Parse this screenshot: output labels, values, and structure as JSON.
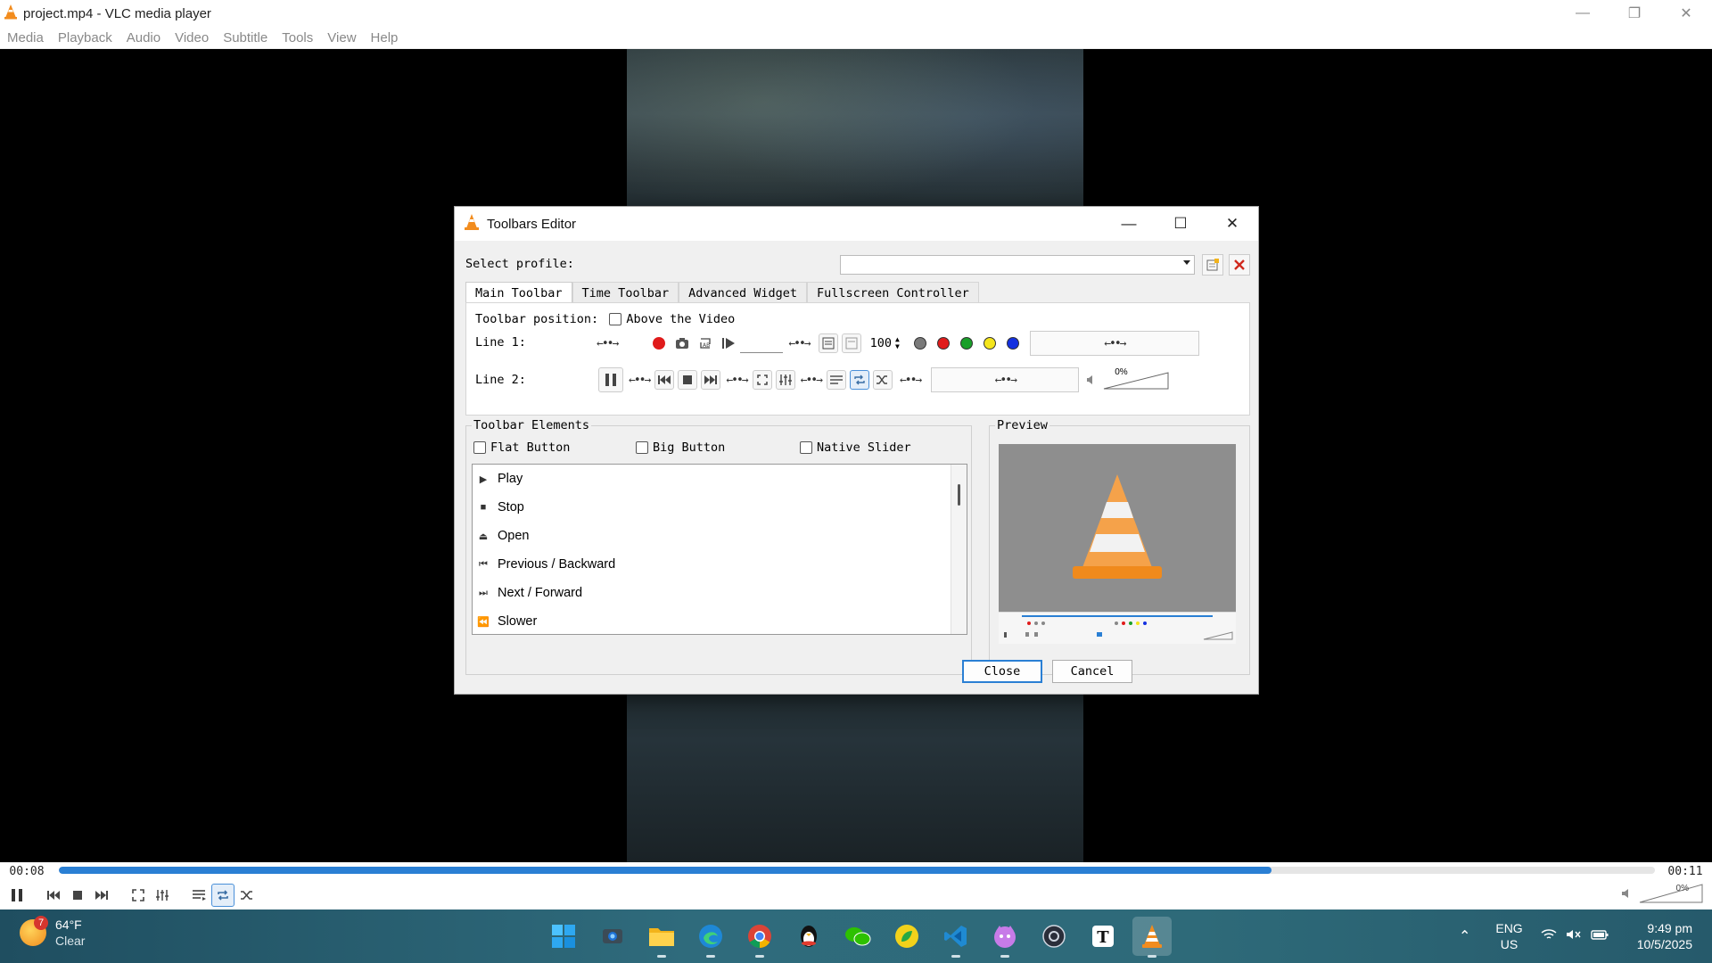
{
  "window": {
    "title": "project.mp4 - VLC media player"
  },
  "menu": [
    "Media",
    "Playback",
    "Audio",
    "Video",
    "Subtitle",
    "Tools",
    "View",
    "Help"
  ],
  "player": {
    "elapsed": "00:08",
    "total": "00:11",
    "progress_fraction": 0.76,
    "volume_label": "0%",
    "volume_fraction": 0.0
  },
  "dialog": {
    "title": "Toolbars Editor",
    "select_profile_label": "Select profile:",
    "profile_value": "",
    "tabs": [
      "Main Toolbar",
      "Time Toolbar",
      "Advanced Widget",
      "Fullscreen Controller"
    ],
    "toolbar_position_label": "Toolbar position:",
    "above_video_label": "Above the Video",
    "above_video_checked": false,
    "line1_label": "Line 1:",
    "line2_label": "Line 2:",
    "line1_speed_value": "100",
    "line2_volume_label": "0%",
    "elements_title": "Toolbar Elements",
    "options": [
      {
        "label": "Flat Button",
        "checked": false
      },
      {
        "label": "Big Button",
        "checked": false
      },
      {
        "label": "Native Slider",
        "checked": false
      }
    ],
    "elements": [
      {
        "label": "Play",
        "icon": "play-icon"
      },
      {
        "label": "Stop",
        "icon": "stop-icon"
      },
      {
        "label": "Open",
        "icon": "eject-icon"
      },
      {
        "label": "Previous / Backward",
        "icon": "previous-icon"
      },
      {
        "label": "Next / Forward",
        "icon": "next-icon"
      },
      {
        "label": "Slower",
        "icon": "slower-icon"
      }
    ],
    "preview_title": "Preview",
    "close_label": "Close",
    "cancel_label": "Cancel"
  },
  "taskbar": {
    "weather_temp": "64°F",
    "weather_cond": "Clear",
    "weather_badge": "7",
    "lang_top": "ENG",
    "lang_bottom": "US",
    "time": "9:49 pm",
    "date": "10/5/2025"
  },
  "colors": {
    "accent": "#2a7fd4",
    "vlc_orange": "#f28c1e"
  }
}
